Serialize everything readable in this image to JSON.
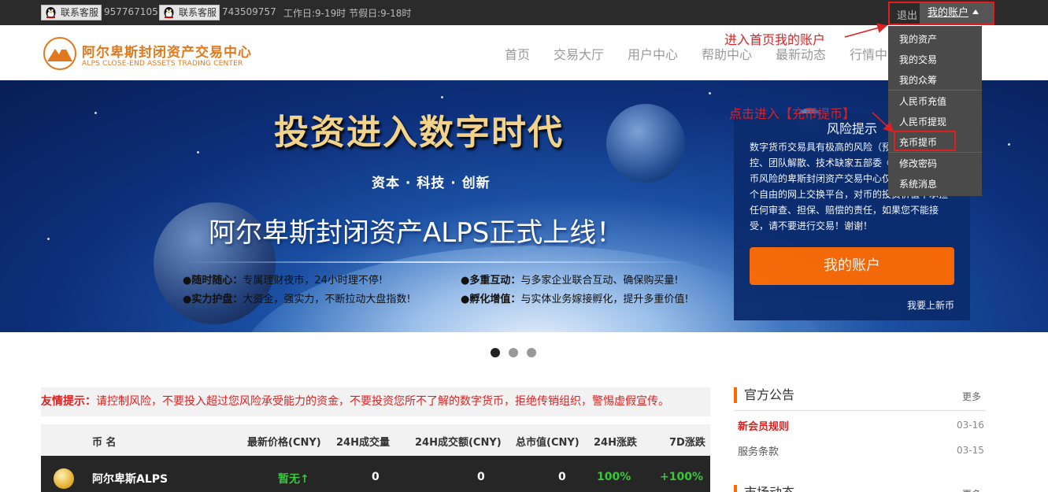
{
  "topbar": {
    "service_label": "联系客服",
    "qq1": "957767105",
    "qq2": "743509757",
    "worktime": "工作日:9-19时 节假日:9-18时",
    "logout": "退出",
    "my_account": "我的账户"
  },
  "header": {
    "logo_cn": "阿尔卑斯封闭资产交易中心",
    "logo_en": "ALPS CLOSE-END ASSETS TRADING CENTER",
    "nav": [
      "首页",
      "交易大厅",
      "用户中心",
      "帮助中心",
      "最新动态",
      "行情中"
    ]
  },
  "annotations": {
    "enter_account": "进入首页我的账户",
    "click_deposit": "点击进入【充币提币】"
  },
  "dropdown": {
    "items": [
      "我的资产",
      "我的交易",
      "我的众筹",
      "人民币充值",
      "人民币提现",
      "充币提币",
      "修改密码",
      "系统消息"
    ]
  },
  "banner": {
    "title": "投资进入数字时代",
    "subtitle": "资本 · 科技 ·  创新",
    "main": "阿尔卑斯封闭资产ALPS正式上线！",
    "features": [
      {
        "label": "●随时随心：",
        "text": "专属理财夜市，24小时理不停!"
      },
      {
        "label": "●多重互动：",
        "text": "与多家企业联合互动、确保购买量!"
      },
      {
        "label": "●实力护盘：",
        "text": "大资金，强实力，不断拉动大盘指数!"
      },
      {
        "label": "●孵化增值：",
        "text": "与实体业务嫁接孵化，提升多重价值!"
      }
    ]
  },
  "risk": {
    "title": "风险提示",
    "text": "数字货币交易具有极高的风险（预跌、庄家操控、团队解散、技术缺家五部委《关于防范比特币风险的卑斯封闭资产交易中心仅为数字货供一个自由的网上交换平台，对币的投资价值不承担任何审查、担保、赔偿的责任，如果您不能接受，请不要进行交易！谢谢！",
    "button": "我的账户",
    "link": "我要上新币"
  },
  "notice": {
    "label": "友情提示：",
    "text": "请控制风险，不要投入超过您风险承受能力的资金，不要投资您所不了解的数字货币，拒绝传销组织，警惕虚假宣传。"
  },
  "market": {
    "headers": [
      "币 名",
      "最新价格(CNY)",
      "24H成交量",
      "24H成交额(CNY)",
      "总市值(CNY)",
      "24H涨跌",
      "7D涨跌"
    ],
    "rows": [
      {
        "name": "阿尔卑斯ALPS",
        "price": "暂无↑",
        "volume": "0",
        "amount": "0",
        "cap": "0",
        "change24": "100%",
        "change7": "+100%"
      }
    ]
  },
  "announcements": {
    "title": "官方公告",
    "more": "更多",
    "items": [
      {
        "title": "新会员规则",
        "date": "03-16"
      },
      {
        "title": "服务条款",
        "date": "03-15"
      }
    ],
    "title2": "市场动态",
    "more2": "更多"
  },
  "colors": {
    "accent": "#ff6a00",
    "annotation": "#e02020",
    "topbar": "#2b2b2b",
    "logo": "#e0791d"
  }
}
